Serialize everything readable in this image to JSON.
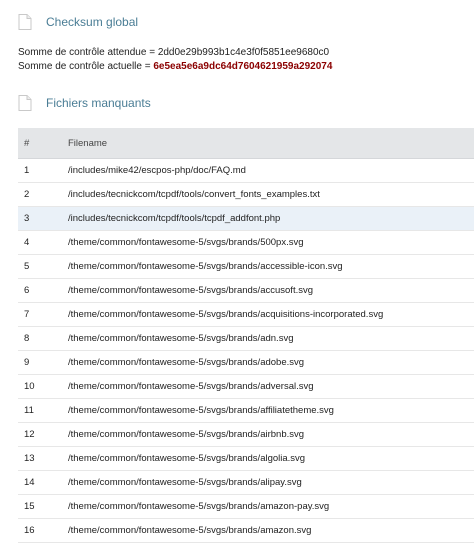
{
  "checksum_section": {
    "title": "Checksum global",
    "expected_label": "Somme de contrôle attendue = ",
    "expected_value": "2dd0e29b993b1c4e3f0f5851ee9680c0",
    "actual_label": "Somme de contrôle actuelle = ",
    "actual_value": "6e5ea5e6a9dc64d7604621959a292074"
  },
  "missing_section": {
    "title": "Fichiers manquants"
  },
  "table": {
    "headers": {
      "num": "#",
      "filename": "Filename"
    },
    "rows": [
      {
        "num": "1",
        "filename": "/includes/mike42/escpos-php/doc/FAQ.md"
      },
      {
        "num": "2",
        "filename": "/includes/tecnickcom/tcpdf/tools/convert_fonts_examples.txt"
      },
      {
        "num": "3",
        "filename": "/includes/tecnickcom/tcpdf/tools/tcpdf_addfont.php"
      },
      {
        "num": "4",
        "filename": "/theme/common/fontawesome-5/svgs/brands/500px.svg"
      },
      {
        "num": "5",
        "filename": "/theme/common/fontawesome-5/svgs/brands/accessible-icon.svg"
      },
      {
        "num": "6",
        "filename": "/theme/common/fontawesome-5/svgs/brands/accusoft.svg"
      },
      {
        "num": "7",
        "filename": "/theme/common/fontawesome-5/svgs/brands/acquisitions-incorporated.svg"
      },
      {
        "num": "8",
        "filename": "/theme/common/fontawesome-5/svgs/brands/adn.svg"
      },
      {
        "num": "9",
        "filename": "/theme/common/fontawesome-5/svgs/brands/adobe.svg"
      },
      {
        "num": "10",
        "filename": "/theme/common/fontawesome-5/svgs/brands/adversal.svg"
      },
      {
        "num": "11",
        "filename": "/theme/common/fontawesome-5/svgs/brands/affiliatetheme.svg"
      },
      {
        "num": "12",
        "filename": "/theme/common/fontawesome-5/svgs/brands/airbnb.svg"
      },
      {
        "num": "13",
        "filename": "/theme/common/fontawesome-5/svgs/brands/algolia.svg"
      },
      {
        "num": "14",
        "filename": "/theme/common/fontawesome-5/svgs/brands/alipay.svg"
      },
      {
        "num": "15",
        "filename": "/theme/common/fontawesome-5/svgs/brands/amazon-pay.svg"
      },
      {
        "num": "16",
        "filename": "/theme/common/fontawesome-5/svgs/brands/amazon.svg"
      }
    ]
  },
  "icons": {
    "section": "file-icon"
  },
  "colors": {
    "title": "#4a7d95",
    "mismatch": "#8b0000",
    "highlight_row": "#eaf1f8"
  }
}
